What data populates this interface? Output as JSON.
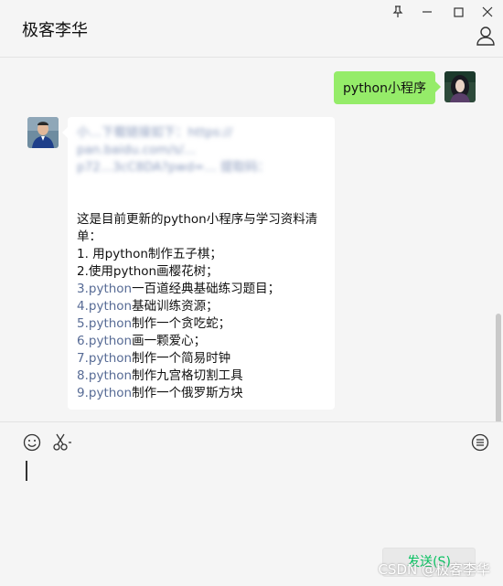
{
  "window": {
    "title": "极客李华",
    "controls": [
      "pin-icon",
      "minimize-icon",
      "maximize-icon",
      "close-icon"
    ]
  },
  "messages": {
    "outgoing": {
      "text": "python小程序"
    },
    "incoming": {
      "blurred_lines": [
        "小…下载链接如下：https://",
        "pan.baidu.com/s/…",
        "p72…3cC8DA?pwd=… 提取码："
      ],
      "blank": "",
      "intro": [
        "这是目前更新的python小程序与学习资料清",
        "单："
      ],
      "items": [
        {
          "num": "1.",
          "py": " 用python",
          "rest": "制作五子棋；",
          "linked": false
        },
        {
          "num": "2.",
          "py": "使用python",
          "rest": "画樱花树；",
          "linked": false
        },
        {
          "num": "3.",
          "py": "python",
          "rest": "一百道经典基础练习题目；",
          "linked": true
        },
        {
          "num": "4.",
          "py": "python",
          "rest": "基础训练资源；",
          "linked": true
        },
        {
          "num": "5.",
          "py": "python",
          "rest": "制作一个贪吃蛇；",
          "linked": true
        },
        {
          "num": "6.",
          "py": "python",
          "rest": "画一颗爱心；",
          "linked": true
        },
        {
          "num": "7.",
          "py": "python",
          "rest": "制作一个简易时钟",
          "linked": true
        },
        {
          "num": "8.",
          "py": "python",
          "rest": "制作九宫格切割工具",
          "linked": true
        },
        {
          "num": "9.",
          "py": "python",
          "rest": "制作一个俄罗斯方块",
          "linked": true
        }
      ]
    }
  },
  "input": {
    "send_label": "发送(S)",
    "tools": [
      "emoji-icon",
      "scissors-icon",
      "chat-history-icon"
    ]
  },
  "watermark": "CSDN @极客李华",
  "colors": {
    "outgoing_bubble": "#95ec69",
    "link": "#576b95",
    "send_text": "#07c160"
  }
}
